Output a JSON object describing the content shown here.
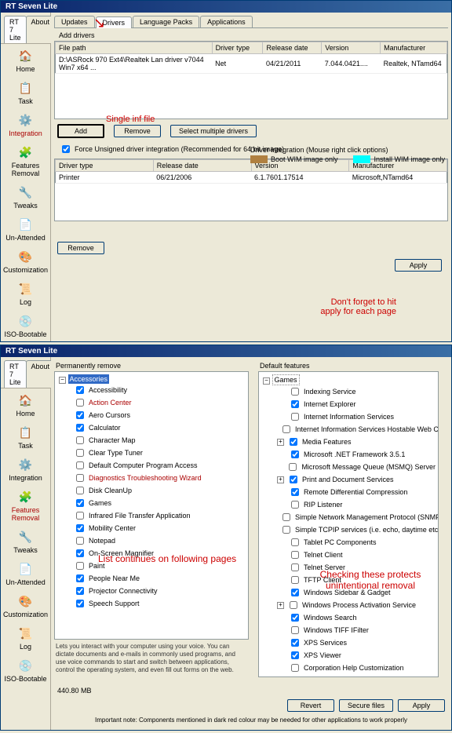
{
  "app_title": "RT Seven Lite",
  "side_tabs": {
    "main": "RT 7 Lite",
    "about": "About"
  },
  "sidebar": {
    "items": [
      {
        "label": "Home",
        "icon": "🏠"
      },
      {
        "label": "Task",
        "icon": "📋"
      },
      {
        "label": "Integration",
        "icon": "⚙️"
      },
      {
        "label": "Features Removal",
        "icon": "🧩"
      },
      {
        "label": "Tweaks",
        "icon": "🔧"
      },
      {
        "label": "Un-Attended",
        "icon": "📄"
      },
      {
        "label": "Customization",
        "icon": "🎨"
      },
      {
        "label": "Log",
        "icon": "📜"
      },
      {
        "label": "ISO-Bootable",
        "icon": "💿"
      }
    ]
  },
  "inner_tabs": [
    "Updates",
    "Drivers",
    "Language Packs",
    "Applications"
  ],
  "drivers": {
    "add_label": "Add drivers",
    "headers": [
      "File path",
      "Driver type",
      "Release date",
      "Version",
      "Manufacturer"
    ],
    "row": [
      "D:\\ASRock 970 Ext4\\Realtek Lan driver v7044 Win7 x64 ...",
      "Net",
      "04/21/2011",
      "7.044.0421....",
      "Realtek, NTamd64"
    ],
    "buttons": {
      "add": "Add",
      "remove": "Remove",
      "select_multi": "Select multiple drivers"
    },
    "force_unsigned": "Force Unsigned driver integration (Recommended for 64 bit image)",
    "opts_title": "Driver integration (Mouse right click options)",
    "opt_boot": "Boot WIM image only",
    "opt_install": "Install WIM image only",
    "headers2": [
      "Driver type",
      "Release date",
      "Version",
      "Manufacturer"
    ],
    "row2": [
      "Printer",
      "06/21/2006",
      "6.1.7601.17514",
      "Microsoft,NTamd64"
    ]
  },
  "apply_btn": "Apply",
  "remove_btn": "Remove",
  "annot": {
    "single_inf": "Single inf file",
    "dont_forget": "Don't forget to hit apply for each page",
    "list_continues": "List continues on following pages",
    "checking": "Checking these protects unintentional removal"
  },
  "features": {
    "perm_label": "Permanently remove",
    "def_label": "Default features",
    "root": "Accessories",
    "perm_items": [
      {
        "t": "Accessibility",
        "c": true,
        "r": false
      },
      {
        "t": "Action Center",
        "c": false,
        "r": true
      },
      {
        "t": "Aero Cursors",
        "c": true,
        "r": false
      },
      {
        "t": "Calculator",
        "c": true,
        "r": false
      },
      {
        "t": "Character Map",
        "c": false,
        "r": false
      },
      {
        "t": "Clear Type Tuner",
        "c": false,
        "r": false
      },
      {
        "t": "Default Computer Program Access",
        "c": false,
        "r": false
      },
      {
        "t": "Diagnostics Troubleshooting Wizard",
        "c": false,
        "r": true
      },
      {
        "t": "Disk CleanUp",
        "c": false,
        "r": false
      },
      {
        "t": "Games",
        "c": true,
        "r": false
      },
      {
        "t": "Infrared File Transfer Application",
        "c": false,
        "r": false
      },
      {
        "t": "Mobility Center",
        "c": true,
        "r": false
      },
      {
        "t": "Notepad",
        "c": false,
        "r": false
      },
      {
        "t": "On-Screen Magnifier",
        "c": true,
        "r": false
      },
      {
        "t": "Paint",
        "c": false,
        "r": false
      },
      {
        "t": "People Near Me",
        "c": true,
        "r": false
      },
      {
        "t": "Projector Connectivity",
        "c": true,
        "r": false
      },
      {
        "t": "Speech Support",
        "c": true,
        "r": false
      }
    ],
    "def_root": "Games",
    "def_items": [
      {
        "t": "Indexing Service",
        "c": false
      },
      {
        "t": "Internet Explorer",
        "c": true
      },
      {
        "t": "Internet Information Services",
        "c": false
      },
      {
        "t": "Internet Information Services Hostable Web Core",
        "c": false
      },
      {
        "t": "Media Features",
        "c": true
      },
      {
        "t": "Microsoft .NET Framework 3.5.1",
        "c": true
      },
      {
        "t": "Microsoft Message Queue (MSMQ) Server",
        "c": false
      },
      {
        "t": "Print and Document Services",
        "c": true
      },
      {
        "t": "Remote Differential Compression",
        "c": true
      },
      {
        "t": "RIP Listener",
        "c": false
      },
      {
        "t": "Simple Network Management Protocol (SNMP)",
        "c": false
      },
      {
        "t": "Simple TCPIP services (i.e. echo, daytime etc)",
        "c": false
      },
      {
        "t": "Tablet PC Components",
        "c": false
      },
      {
        "t": "Telnet Client",
        "c": false
      },
      {
        "t": "Telnet Server",
        "c": false
      },
      {
        "t": "TFTP Client",
        "c": false
      },
      {
        "t": "Windows Sidebar & Gadget",
        "c": true
      },
      {
        "t": "Windows Process Activation Service",
        "c": false
      },
      {
        "t": "Windows Search",
        "c": true
      },
      {
        "t": "Windows TIFF IFilter",
        "c": false
      },
      {
        "t": "XPS Services",
        "c": true
      },
      {
        "t": "XPS Viewer",
        "c": true
      },
      {
        "t": "Corporation Help Customization",
        "c": false
      }
    ],
    "desc": "Lets you interact with your computer using your voice. You can dictate documents and e-mails in commonly used programs, and use voice commands to start and switch between applications, control the operating system, and even fill out forms on the web.",
    "size": "440.80 MB",
    "buttons": {
      "revert": "Revert",
      "secure": "Secure files",
      "apply": "Apply"
    },
    "note": "Important note: Components mentioned in dark red colour may be needed for other applications to work properly"
  }
}
